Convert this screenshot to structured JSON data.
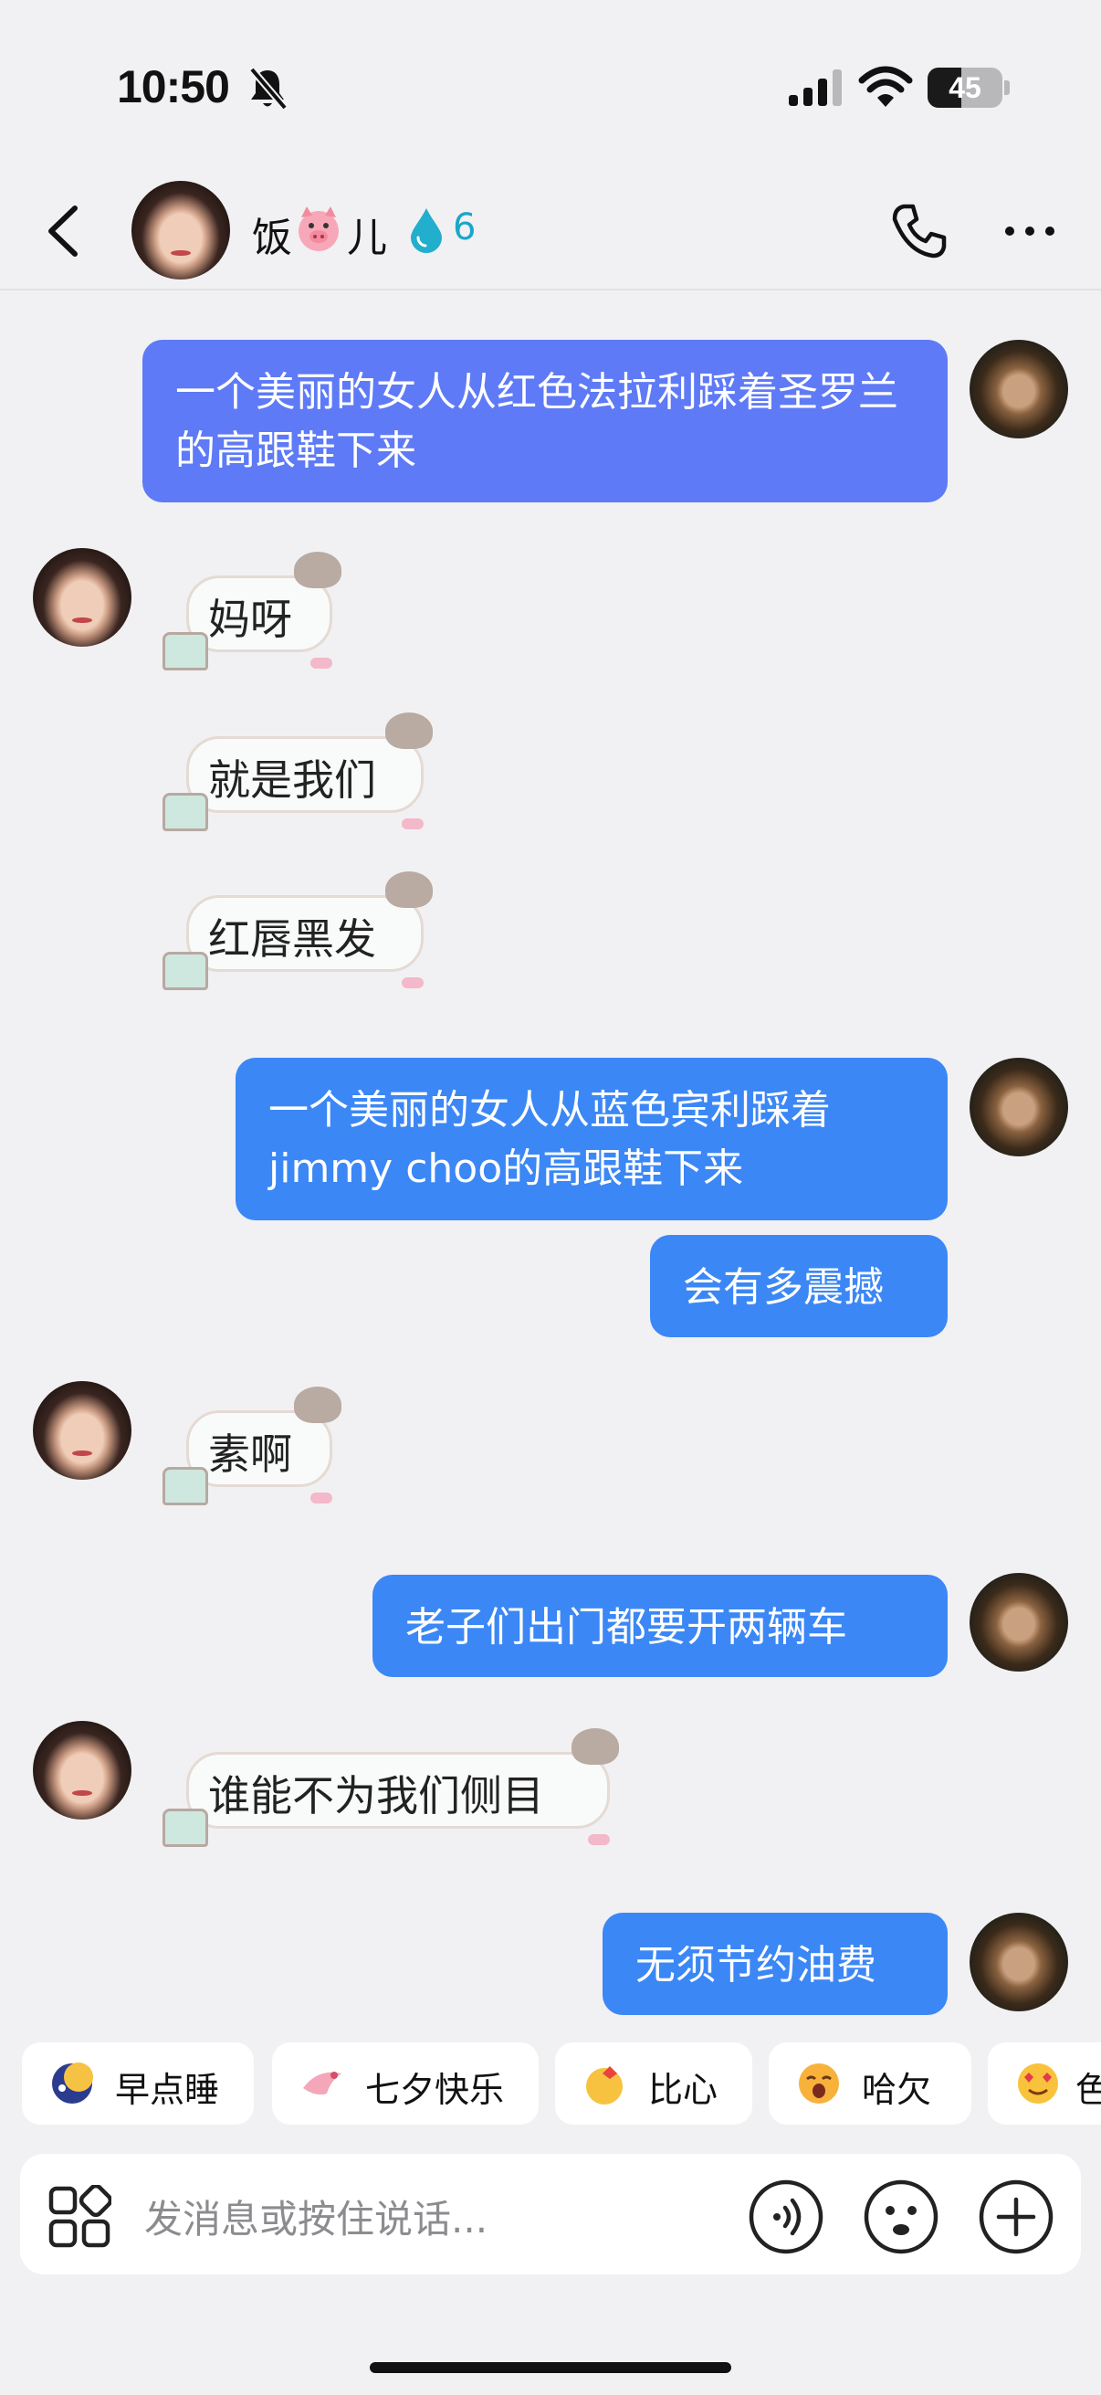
{
  "status_bar": {
    "time": "10:50",
    "battery": "45",
    "battery_level": 0.45
  },
  "header": {
    "contact_name_prefix": "饭",
    "contact_name_suffix": "儿",
    "intimacy_count": "6"
  },
  "messages": [
    {
      "side": "me",
      "style": "purple",
      "text": "一个美丽的女人从红色法拉利踩着圣罗兰的高跟鞋下来"
    },
    {
      "side": "them",
      "type": "sticker",
      "text": "妈呀"
    },
    {
      "side": "them",
      "type": "sticker",
      "text": "就是我们"
    },
    {
      "side": "them",
      "type": "sticker",
      "text": "红唇黑发"
    },
    {
      "side": "me",
      "style": "blue",
      "text": "一个美丽的女人从蓝色宾利踩着jimmy choo的高跟鞋下来"
    },
    {
      "side": "me",
      "style": "blue",
      "text": "会有多震撼"
    },
    {
      "side": "them",
      "type": "sticker",
      "text": "素啊"
    },
    {
      "side": "me",
      "style": "blue",
      "text": "老子们出门都要开两辆车"
    },
    {
      "side": "them",
      "type": "sticker",
      "text": "谁能不为我们侧目"
    },
    {
      "side": "me",
      "style": "blue",
      "text": "无须节约油费"
    }
  ],
  "quick_replies": [
    {
      "label": "早点睡",
      "icon": "moon-sleep-icon"
    },
    {
      "label": "七夕快乐",
      "icon": "magpie-icon"
    },
    {
      "label": "比心",
      "icon": "finger-heart-icon"
    },
    {
      "label": "哈欠",
      "icon": "yawn-face-icon"
    },
    {
      "label": "色",
      "icon": "heart-eyes-icon"
    }
  ],
  "input": {
    "placeholder": "发消息或按住说话..."
  },
  "colors": {
    "background": "#f1f1f3",
    "bubble_purple": "#5e7af6",
    "bubble_blue": "#3b87f6",
    "intimacy_accent": "#1aa6c8"
  }
}
